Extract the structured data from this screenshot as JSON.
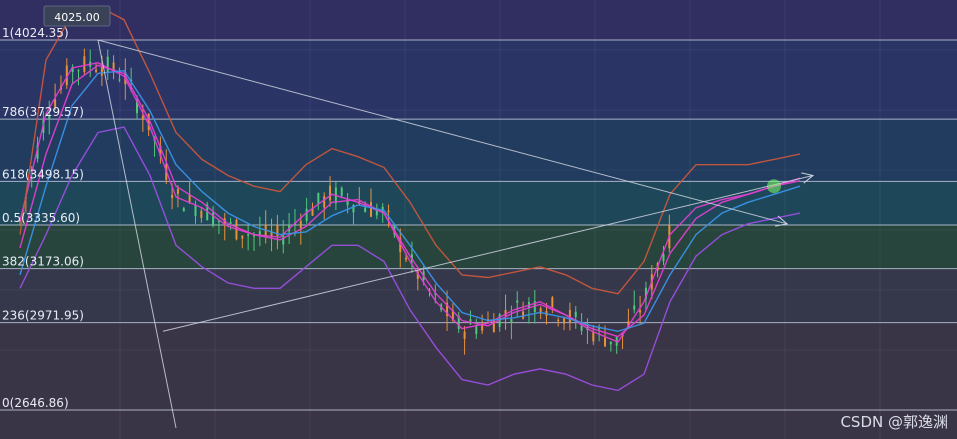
{
  "chart_data": {
    "type": "line",
    "title": "",
    "xlabel": "",
    "ylabel": "",
    "price_tag": "4025.00",
    "ylim": [
      2600,
      4080
    ],
    "x_range": [
      0,
      120
    ],
    "fib_levels": [
      {
        "label": "1(4024.35)",
        "value": 4024.35
      },
      {
        "label": "786(3729.57)",
        "value": 3729.57
      },
      {
        "label": "618(3498.15)",
        "value": 3498.15
      },
      {
        "label": "0.5(3335.60)",
        "value": 3335.6
      },
      {
        "label": "382(3173.06)",
        "value": 3173.06
      },
      {
        "label": "236(2971.95)",
        "value": 2971.95
      },
      {
        "label": "0(2646.86)",
        "value": 2646.86
      }
    ],
    "zone_colors": [
      "#312f62",
      "#2b3666",
      "#213d60",
      "#1e4a5a",
      "#27473c",
      "#35394a",
      "#3b3547"
    ],
    "series_colors": {
      "upper_band": "#c8563d",
      "lower_band": "#9a4fe0",
      "fast_ma": "#e23fd0",
      "slow_ma": "#3a93e8",
      "up_candle": "#e8913a",
      "down_candle": "#4fc97a"
    },
    "series": [
      {
        "x": [
          0,
          4,
          8,
          12,
          16,
          20,
          24,
          28,
          32,
          36,
          40,
          44,
          48,
          52,
          56,
          60,
          64,
          68,
          72,
          76,
          80,
          84,
          88,
          92,
          96,
          100,
          104,
          108,
          112,
          116,
          120
        ],
        "values": [
          3350,
          3750,
          3920,
          3940,
          3890,
          3700,
          3440,
          3400,
          3330,
          3300,
          3290,
          3380,
          3450,
          3420,
          3380,
          3200,
          3050,
          2950,
          2970,
          3020,
          3050,
          3000,
          2940,
          2900,
          3050,
          3300,
          3400,
          3430,
          3450,
          3480,
          3500
        ]
      },
      {
        "x": [
          0,
          4,
          8,
          12,
          16,
          20,
          24,
          28,
          32,
          36,
          40,
          44,
          48,
          52,
          56,
          60,
          64,
          68,
          72,
          76,
          80,
          84,
          88,
          92,
          96,
          100,
          104,
          108,
          112,
          116,
          120
        ],
        "values": [
          3250,
          3600,
          3860,
          3930,
          3900,
          3720,
          3480,
          3420,
          3340,
          3300,
          3280,
          3330,
          3420,
          3430,
          3380,
          3220,
          3080,
          2980,
          2960,
          3010,
          3040,
          3000,
          2950,
          2920,
          3000,
          3230,
          3360,
          3420,
          3450,
          3480,
          3510
        ]
      },
      {
        "x": [
          0,
          4,
          8,
          12,
          16,
          20,
          24,
          28,
          32,
          36,
          40,
          44,
          48,
          52,
          56,
          60,
          64,
          68,
          72,
          76,
          80,
          84,
          88,
          92,
          96,
          100,
          104,
          108,
          112,
          116,
          120
        ],
        "values": [
          3150,
          3480,
          3780,
          3900,
          3910,
          3760,
          3560,
          3460,
          3380,
          3330,
          3300,
          3310,
          3370,
          3410,
          3390,
          3260,
          3120,
          3010,
          2980,
          2990,
          3010,
          2990,
          2960,
          2940,
          2970,
          3150,
          3300,
          3380,
          3420,
          3450,
          3480
        ]
      },
      {
        "x": [
          0,
          4,
          8,
          12,
          16,
          20,
          24,
          28,
          32,
          36,
          40,
          44,
          48,
          52,
          56,
          60,
          64,
          68,
          72,
          76,
          80,
          84,
          88,
          92,
          96,
          100,
          104,
          108,
          112,
          116,
          120
        ],
        "values": [
          3300,
          3950,
          4120,
          4150,
          4100,
          3900,
          3680,
          3580,
          3520,
          3480,
          3460,
          3560,
          3620,
          3590,
          3550,
          3420,
          3260,
          3150,
          3140,
          3160,
          3180,
          3150,
          3100,
          3080,
          3200,
          3450,
          3560,
          3560,
          3560,
          3580,
          3600
        ]
      },
      {
        "x": [
          0,
          4,
          8,
          12,
          16,
          20,
          24,
          28,
          32,
          36,
          40,
          44,
          48,
          52,
          56,
          60,
          64,
          68,
          72,
          76,
          80,
          84,
          88,
          92,
          96,
          100,
          104,
          108,
          112,
          116,
          120
        ],
        "values": [
          3100,
          3300,
          3520,
          3680,
          3700,
          3520,
          3260,
          3180,
          3120,
          3100,
          3100,
          3180,
          3260,
          3260,
          3200,
          3020,
          2880,
          2760,
          2740,
          2780,
          2800,
          2780,
          2740,
          2720,
          2780,
          3050,
          3220,
          3300,
          3340,
          3360,
          3380
        ]
      }
    ],
    "lines": [
      {
        "from": [
          12,
          4024.35
        ],
        "to": [
          118,
          3340
        ]
      },
      {
        "from": [
          22,
          2940
        ],
        "to": [
          122,
          3520
        ]
      },
      {
        "from": [
          12,
          4024.35
        ],
        "to": [
          24,
          2580
        ]
      }
    ],
    "watermark": "CSDN @郭逸渊"
  }
}
